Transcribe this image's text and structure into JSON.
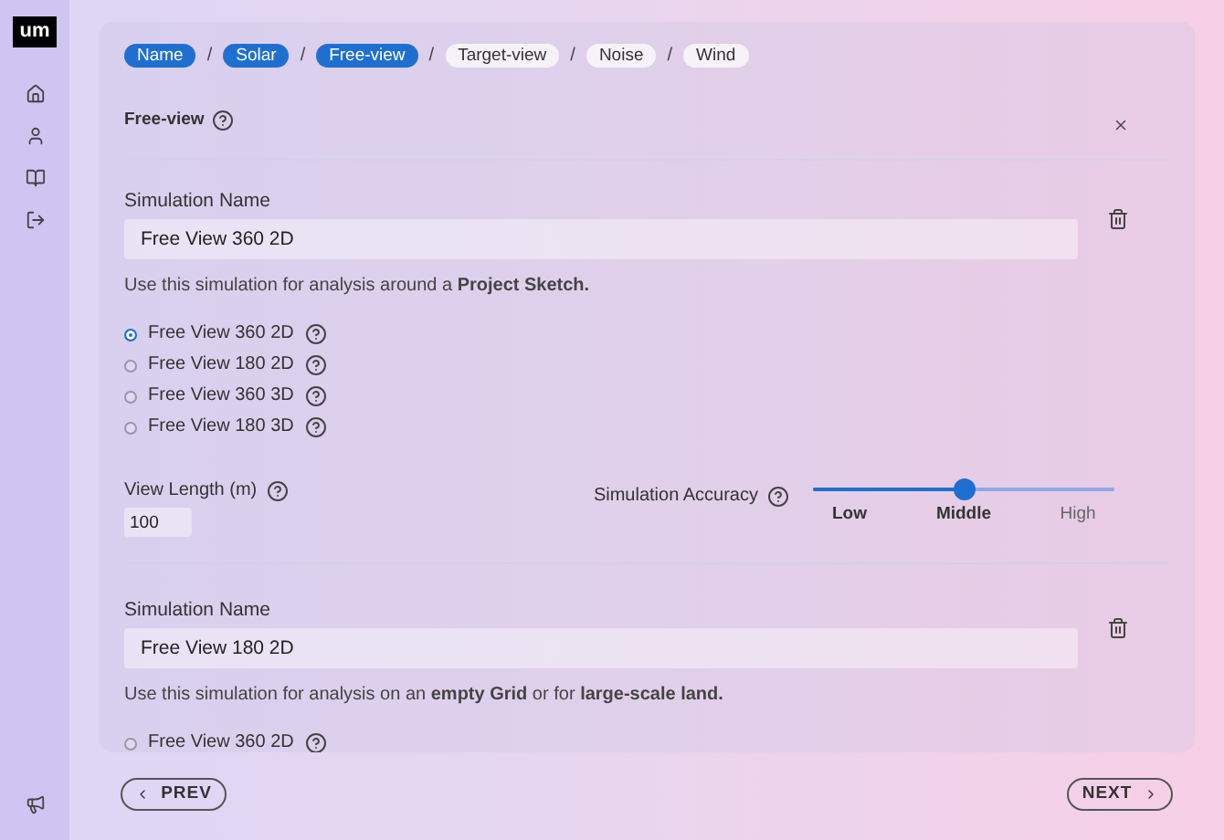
{
  "logo": "um",
  "breadcrumbs": [
    {
      "label": "Name",
      "selected": true
    },
    {
      "label": "Solar",
      "selected": true
    },
    {
      "label": "Free-view",
      "selected": true
    },
    {
      "label": "Target-view",
      "selected": false
    },
    {
      "label": "Noise",
      "selected": false
    },
    {
      "label": "Wind",
      "selected": false
    }
  ],
  "separators": [
    "/",
    "/",
    "/",
    "/",
    "/"
  ],
  "section": {
    "title": "Free-view"
  },
  "simulations": [
    {
      "name_label": "Simulation Name",
      "value": "Free View 360 2D",
      "description": "Use this simulation for analysis around a **Project Sketch.**",
      "options": [
        {
          "label": "Free View 360 2D",
          "selected": true
        },
        {
          "label": "Free View 180 2D",
          "selected": false
        },
        {
          "label": "Free View 360 3D",
          "selected": false
        },
        {
          "label": "Free View 180 3D",
          "selected": false
        }
      ],
      "view_length": {
        "label": "View Length (m)",
        "value": "100"
      },
      "accuracy": {
        "label": "Simulation Accuracy",
        "level": 0.5,
        "stops": [
          {
            "label": "Low",
            "active": true
          },
          {
            "label": "Middle",
            "active": true
          },
          {
            "label": "High",
            "active": false
          }
        ]
      }
    },
    {
      "name_label": "Simulation Name",
      "value": "Free View 180 2D",
      "description": "Use this simulation for analysis on an **empty Grid** or for **large-scale land.**",
      "options": [
        {
          "label": "Free View 360 2D",
          "selected": false
        }
      ]
    }
  ],
  "buttons": {
    "prev": "PREV",
    "next": "NEXT"
  }
}
